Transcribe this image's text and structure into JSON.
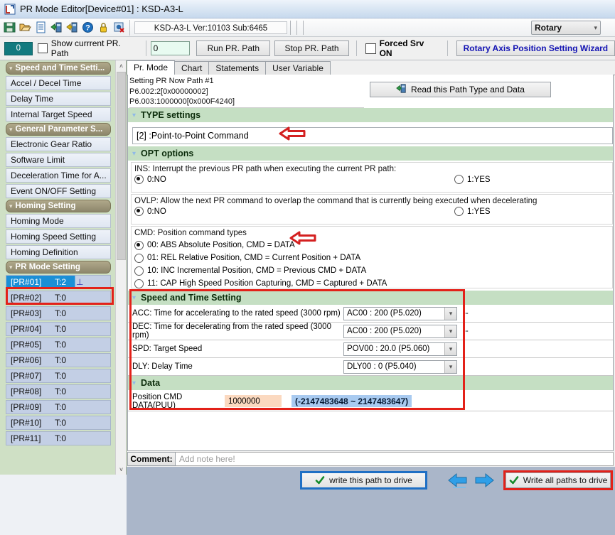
{
  "window": {
    "title": "PR Mode Editor[Device#01]  : KSD-A3-L",
    "icon": "pr-editor-icon"
  },
  "toolbar": {
    "icons": [
      "save-icon",
      "open-icon",
      "new-document-icon",
      "import-icon",
      "export-icon",
      "help-icon",
      "lock-icon",
      "settings-reset-icon"
    ],
    "version_field": "KSD-A3-L Ver:10103 Sub:6465",
    "rotary_select": {
      "value": "Rotary",
      "chevron": "v"
    }
  },
  "toolbar2": {
    "current_path_number": "0",
    "show_current_checkbox_label": "Show currrent PR. Path",
    "show_current_checked": false,
    "path_input_value": "0",
    "run_button": "Run PR. Path",
    "stop_button": "Stop PR. Path",
    "forced_srv_label": "Forced Srv ON",
    "forced_srv_checked": false,
    "wizard_button": "Rotary Axis Position Setting Wizard"
  },
  "sidebar": {
    "groups": [
      {
        "name": "Speed and Time Setti...",
        "items": [
          "Accel / Decel Time",
          "Delay Time",
          "Internal Target Speed"
        ]
      },
      {
        "name": "General Parameter S...",
        "items": [
          "Electronic Gear Ratio",
          "Software Limit",
          "Deceleration Time for A...",
          "Event ON/OFF Setting"
        ]
      },
      {
        "name": "Homing Setting",
        "items": [
          "Homing Mode",
          "Homing Speed Setting",
          "Homing Definition"
        ]
      }
    ],
    "pr_group_name": "PR Mode Setting",
    "pr_items": [
      {
        "id": "[PR#01]",
        "type": "T:2",
        "symbol": "⊥",
        "selected": true
      },
      {
        "id": "[PR#02]",
        "type": "T:0",
        "symbol": "",
        "selected": false
      },
      {
        "id": "[PR#03]",
        "type": "T:0",
        "symbol": "",
        "selected": false
      },
      {
        "id": "[PR#04]",
        "type": "T:0",
        "symbol": "",
        "selected": false
      },
      {
        "id": "[PR#05]",
        "type": "T:0",
        "symbol": "",
        "selected": false
      },
      {
        "id": "[PR#06]",
        "type": "T:0",
        "symbol": "",
        "selected": false
      },
      {
        "id": "[PR#07]",
        "type": "T:0",
        "symbol": "",
        "selected": false
      },
      {
        "id": "[PR#08]",
        "type": "T:0",
        "symbol": "",
        "selected": false
      },
      {
        "id": "[PR#09]",
        "type": "T:0",
        "symbol": "",
        "selected": false
      },
      {
        "id": "[PR#10]",
        "type": "T:0",
        "symbol": "",
        "selected": false
      },
      {
        "id": "[PR#11]",
        "type": "T:0",
        "symbol": "",
        "selected": false
      }
    ],
    "scroll_up": "˄",
    "scroll_down": "˅"
  },
  "tabs": [
    {
      "label": "Pr. Mode",
      "active": true
    },
    {
      "label": "Chart",
      "active": false
    },
    {
      "label": "Statements",
      "active": false
    },
    {
      "label": "User Variable",
      "active": false
    }
  ],
  "path_info": {
    "line1": "Setting PR Now Path #1",
    "line2": "P6.002:2[0x00000002]",
    "line3": "P6.003:1000000[0x000F4240]"
  },
  "read_button": {
    "label": "Read this Path Type and Data",
    "icon": "read-data-icon"
  },
  "type_settings": {
    "header": "TYPE settings",
    "value": "[2] :Point-to-Point Command"
  },
  "opt_options": {
    "header": "OPT options",
    "ins": {
      "label": "INS: Interrupt the previous PR path when executing the current PR path:",
      "option_no": "0:NO",
      "option_yes": "1:YES",
      "selected": "0:NO"
    },
    "ovlp": {
      "label": "OVLP: Allow the next PR command to overlap the command that is currently being executed when decelerating",
      "option_no": "0:NO",
      "option_yes": "1:YES",
      "selected": "0:NO"
    },
    "cmd": {
      "label": "CMD: Position command types",
      "options": [
        "00: ABS Absolute Position, CMD = DATA",
        "01: REL Relative Position, CMD = Current Position + DATA",
        "10: INC Incremental Position, CMD = Previous CMD + DATA",
        "11: CAP High Speed Position Capturing, CMD = Captured + DATA"
      ],
      "selected_index": 0
    }
  },
  "speed_time": {
    "header": "Speed and Time Setting",
    "rows": [
      {
        "label": "ACC: Time for accelerating to the rated speed (3000 rpm)",
        "value": "AC00 : 200 (P5.020)",
        "suffix": "--"
      },
      {
        "label": "DEC: Time for decelerating from the rated speed (3000 rpm)",
        "value": "AC00 : 200 (P5.020)",
        "suffix": "--"
      },
      {
        "label": "SPD: Target Speed",
        "value": "POV00 : 20.0 (P5.060)",
        "suffix": ""
      },
      {
        "label": "DLY: Delay Time",
        "value": "DLY00 : 0 (P5.040)",
        "suffix": ""
      }
    ]
  },
  "data_section": {
    "header": "Data",
    "label": "Position CMD DATA(PUU)",
    "value": "1000000",
    "range": "(-2147483648 ~ 2147483647)"
  },
  "comment": {
    "label": "Comment:",
    "placeholder": "Add note here!",
    "value": ""
  },
  "bottom": {
    "write_this_path": "write this path to drive",
    "write_all_paths": "Write all paths to drive",
    "prev_arrow": "prev-path-arrow-icon",
    "next_arrow": "next-path-arrow-icon"
  },
  "annotations": {
    "arrow_type": "red-left-arrow-type-settings",
    "arrow_cmd": "red-left-arrow-cmd-abs",
    "box_pr01": "red-box-pr01",
    "box_speed_data": "red-box-speed-and-data",
    "box_write_all": "red-box-write-all-paths",
    "box_write_this": "blue-box-write-this-path"
  },
  "colors": {
    "red_annotation": "#e32119",
    "blue_annotation": "#1f6fc4",
    "section_header_bg": "#c5dfc3",
    "sidebar_bg": "#cfe0c5",
    "selected_item_bg": "#1b8fd6",
    "data_value_bg": "#fbd9c0",
    "range_bg": "#a8caf0",
    "teal_badge": "#137a7f"
  }
}
